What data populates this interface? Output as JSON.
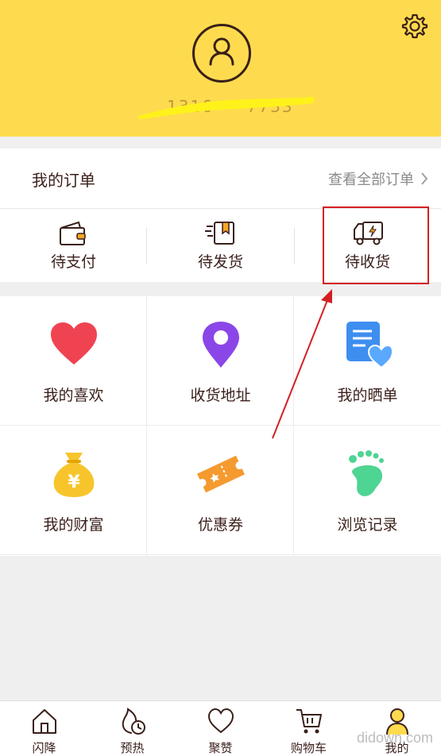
{
  "header": {
    "phone": "1316·····7733",
    "settings_icon": "gear-icon",
    "avatar_icon": "user-icon",
    "bg_color": "#fedb4e"
  },
  "orders": {
    "title": "我的订单",
    "view_all": "查看全部订单",
    "items": [
      {
        "label": "待支付",
        "icon": "wallet-icon"
      },
      {
        "label": "待发货",
        "icon": "package-icon"
      },
      {
        "label": "待收货",
        "icon": "truck-icon"
      }
    ]
  },
  "grid": [
    {
      "label": "我的喜欢",
      "icon": "heart-icon",
      "color": "#f04352"
    },
    {
      "label": "收货地址",
      "icon": "location-pin-icon",
      "color": "#8b46e8"
    },
    {
      "label": "我的晒单",
      "icon": "document-heart-icon",
      "color": "#3e8ef0"
    },
    {
      "label": "我的财富",
      "icon": "money-bag-icon",
      "color": "#f7c52b"
    },
    {
      "label": "优惠券",
      "icon": "coupon-icon",
      "color": "#f59a2f"
    },
    {
      "label": "浏览记录",
      "icon": "footprint-icon",
      "color": "#4ed493"
    }
  ],
  "tabbar": [
    {
      "label": "闪降",
      "icon": "home-icon"
    },
    {
      "label": "预热",
      "icon": "flame-clock-icon"
    },
    {
      "label": "聚赞",
      "icon": "heart-outline-icon"
    },
    {
      "label": "购物车",
      "icon": "cart-icon"
    },
    {
      "label": "我的",
      "icon": "profile-icon",
      "active": true
    }
  ],
  "watermark": "didown.com"
}
